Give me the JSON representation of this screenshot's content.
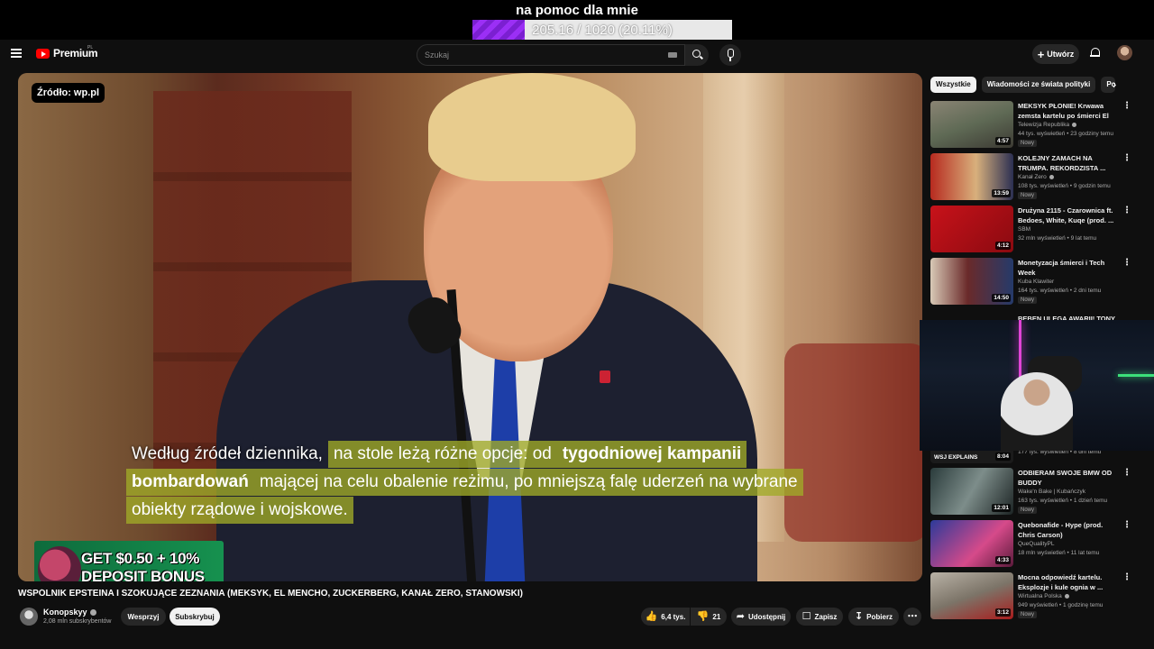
{
  "donation": {
    "title": "na pomoc dla mnie",
    "progress_text": "205.16 / 1020 (20.11%)",
    "progress_fraction": 0.2011
  },
  "header": {
    "logo_text": "Premium",
    "logo_sup": "PL",
    "search_placeholder": "Szukaj",
    "create_label": "Utwórz"
  },
  "player": {
    "source_tag": "Źródło: wp.pl",
    "subtitle_lines": [
      [
        {
          "text": "Według źródeł dziennika,",
          "hl": false,
          "bold": false
        },
        {
          "text": "na stole leżą różne opcje: od ",
          "hl": true,
          "bold": false
        },
        {
          "text": "tygodniowej kampanii",
          "hl": true,
          "bold": true
        }
      ],
      [
        {
          "text": "bombardowań",
          "hl": true,
          "bold": true
        },
        {
          "text": " mającej na celu obalenie reżimu, po mniejszą falę uderzeń na wybrane",
          "hl": true,
          "bold": false
        }
      ],
      [
        {
          "text": "obiekty rządowe i wojskowe.",
          "hl": true,
          "bold": false
        }
      ]
    ],
    "ad_line1": "GET $0.50 + 10%",
    "ad_line2": "DEPOSIT BONUS"
  },
  "video": {
    "title": "WSPÓLNIK EPSTEINA I SZOKUJĄCE ZEZNANIA (MEKSYK, EL MENCHO, ZUCKERBERG, KANAŁ ZERO, STANOWSKI)",
    "channel": "Konopskyy",
    "subscribers": "2,08 mln subskrybentów",
    "support_label": "Wesprzyj",
    "subscribe_label": "Subskrybuj",
    "likes": "6,4 tys.",
    "dislikes": "21",
    "share_label": "Udostępnij",
    "save_label": "Zapisz",
    "download_label": "Pobierz"
  },
  "sidebar": {
    "chips": [
      "Wszystkie",
      "Wiadomości ze świata polityki",
      "Po"
    ],
    "recommendations": [
      {
        "title": "MEKSYK PŁONIE! Krwawa zemsta kartelu po śmierci El ...",
        "channel": "Telewizja Republika",
        "verified": true,
        "meta": "44 tys. wyświetleń • 23 godziny temu",
        "badge": "Nowy",
        "duration": "4:57",
        "thumb": "linear-gradient(160deg,#8a8474,#5f6a55 50%,#3c3a33)"
      },
      {
        "title": "KOLEJNY ZAMACH NA TRUMPA. REKORDZISTA ...",
        "channel": "Kanał Zero",
        "verified": true,
        "meta": "108 tys. wyświetleń • 9 godzin temu",
        "badge": "Nowy",
        "duration": "13:59",
        "thumb": "linear-gradient(90deg,#b72a1f,#d8b07c 55%,#2b2f52)"
      },
      {
        "title": "Drużyna 2115 - Czarownica ft. Bedoes, White, Kuqe (prod. ...",
        "channel": "SBM",
        "verified": false,
        "meta": "32 mln wyświetleń • 9 lat temu",
        "badge": "",
        "duration": "4:12",
        "thumb": "linear-gradient(135deg,#c8121a,#8a0a10)"
      },
      {
        "title": "Monetyzacja śmierci i Tech Week",
        "channel": "Kuba Klawiter",
        "verified": false,
        "meta": "164 tys. wyświetleń • 2 dni temu",
        "badge": "Nowy",
        "duration": "14:50",
        "thumb": "linear-gradient(90deg,#d8c9b6,#6a2a2a 45%,#253a6a)"
      }
    ],
    "lower_recommendations": [
      {
        "title": "ODBIERAM SWOJE BMW OD BUDDY",
        "channel": "Wake'n Bake | Kubańczyk",
        "verified": false,
        "meta": "163 tys. wyświetleń • 1 dzień temu",
        "badge": "Nowy",
        "duration": "12:01",
        "thumb": "linear-gradient(120deg,#2a3b3b,#7d8d8a 50%,#1c2424)"
      },
      {
        "title": "Quebonafide - Hype (prod. Chris Carson)",
        "channel": "QueQualityPL",
        "verified": false,
        "meta": "18 mln wyświetleń • 11 lat temu",
        "badge": "",
        "duration": "4:33",
        "thumb": "linear-gradient(135deg,#2c3a9a,#d64a8a 60%,#5a1a3a)"
      },
      {
        "title": "Mocna odpowiedź kartelu. Eksplozje i kule ognia w ...",
        "channel": "Wirtualna Polska",
        "verified": true,
        "meta": "949 wyświetleń • 1 godzinę temu",
        "badge": "Nowy",
        "duration": "3:12",
        "thumb": "linear-gradient(160deg,#b9b2a6,#7c7468 50%,#a91c1c)"
      }
    ],
    "partial_row": {
      "title": "BEBEN ULEGA AWARII! TONY ...",
      "meta": "177 tys. wyświetleń • 8 dni temu",
      "duration": "8:04",
      "label": "WSJ EXPLAINS"
    }
  }
}
